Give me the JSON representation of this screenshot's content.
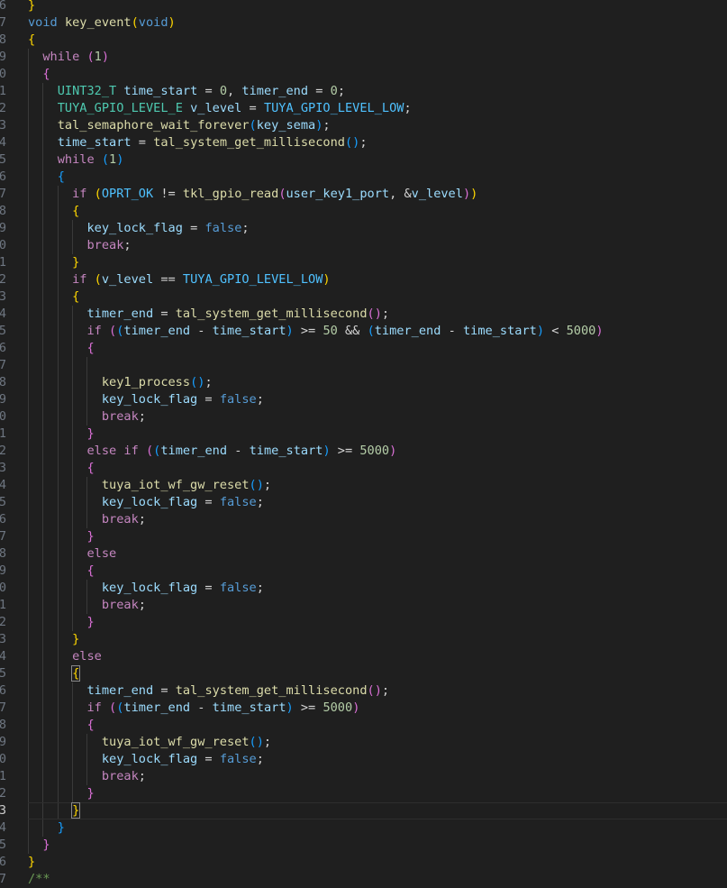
{
  "editor": {
    "line_numbers": [
      "6",
      "7",
      "8",
      "9",
      "0",
      "1",
      "2",
      "3",
      "4",
      "5",
      "6",
      "7",
      "8",
      "9",
      "0",
      "1",
      "2",
      "3",
      "4",
      "5",
      "6",
      "7",
      "8",
      "9",
      "0",
      "1",
      "2",
      "3",
      "4",
      "5",
      "6",
      "7",
      "8",
      "9",
      "0",
      "1",
      "2",
      "3",
      "4",
      "5",
      "6",
      "7",
      "8",
      "9",
      "0",
      "1",
      "2",
      "3",
      "4",
      "5",
      "6",
      "7"
    ],
    "current_line_index": 47,
    "lines": [
      [
        {
          "t": "}",
          "c": "b1"
        }
      ],
      [
        {
          "t": "void",
          "c": "kw"
        },
        {
          "t": " "
        },
        {
          "t": "key_event",
          "c": "fn"
        },
        {
          "t": "(",
          "c": "b1"
        },
        {
          "t": "void",
          "c": "kw"
        },
        {
          "t": ")",
          "c": "b1"
        }
      ],
      [
        {
          "t": "{",
          "c": "b1"
        }
      ],
      [
        {
          "t": "  "
        },
        {
          "t": "while",
          "c": "ctl"
        },
        {
          "t": " "
        },
        {
          "t": "(",
          "c": "b2"
        },
        {
          "t": "1",
          "c": "num"
        },
        {
          "t": ")",
          "c": "b2"
        }
      ],
      [
        {
          "t": "  "
        },
        {
          "t": "{",
          "c": "b2"
        }
      ],
      [
        {
          "t": "    "
        },
        {
          "t": "UINT32_T",
          "c": "ty"
        },
        {
          "t": " "
        },
        {
          "t": "time_start",
          "c": "var"
        },
        {
          "t": " = ",
          "c": "op"
        },
        {
          "t": "0",
          "c": "num"
        },
        {
          "t": ", ",
          "c": "op"
        },
        {
          "t": "timer_end",
          "c": "var"
        },
        {
          "t": " = ",
          "c": "op"
        },
        {
          "t": "0",
          "c": "num"
        },
        {
          "t": ";",
          "c": "op"
        }
      ],
      [
        {
          "t": "    "
        },
        {
          "t": "TUYA_GPIO_LEVEL_E",
          "c": "ty"
        },
        {
          "t": " "
        },
        {
          "t": "v_level",
          "c": "var"
        },
        {
          "t": " = ",
          "c": "op"
        },
        {
          "t": "TUYA_GPIO_LEVEL_LOW",
          "c": "cst"
        },
        {
          "t": ";",
          "c": "op"
        }
      ],
      [
        {
          "t": "    "
        },
        {
          "t": "tal_semaphore_wait_forever",
          "c": "fn"
        },
        {
          "t": "(",
          "c": "b3"
        },
        {
          "t": "key_sema",
          "c": "var"
        },
        {
          "t": ")",
          "c": "b3"
        },
        {
          "t": ";",
          "c": "op"
        }
      ],
      [
        {
          "t": "    "
        },
        {
          "t": "time_start",
          "c": "var"
        },
        {
          "t": " = ",
          "c": "op"
        },
        {
          "t": "tal_system_get_millisecond",
          "c": "fn"
        },
        {
          "t": "()",
          "c": "b3"
        },
        {
          "t": ";",
          "c": "op"
        }
      ],
      [
        {
          "t": "    "
        },
        {
          "t": "while",
          "c": "ctl"
        },
        {
          "t": " "
        },
        {
          "t": "(",
          "c": "b3"
        },
        {
          "t": "1",
          "c": "num"
        },
        {
          "t": ")",
          "c": "b3"
        }
      ],
      [
        {
          "t": "    "
        },
        {
          "t": "{",
          "c": "b3"
        }
      ],
      [
        {
          "t": "      "
        },
        {
          "t": "if",
          "c": "ctl"
        },
        {
          "t": " "
        },
        {
          "t": "(",
          "c": "b1"
        },
        {
          "t": "OPRT_OK",
          "c": "cst"
        },
        {
          "t": " != ",
          "c": "op"
        },
        {
          "t": "tkl_gpio_read",
          "c": "fn"
        },
        {
          "t": "(",
          "c": "b2"
        },
        {
          "t": "user_key1_port",
          "c": "var"
        },
        {
          "t": ", &",
          "c": "op"
        },
        {
          "t": "v_level",
          "c": "var"
        },
        {
          "t": ")",
          "c": "b2"
        },
        {
          "t": ")",
          "c": "b1"
        }
      ],
      [
        {
          "t": "      "
        },
        {
          "t": "{",
          "c": "b1"
        }
      ],
      [
        {
          "t": "        "
        },
        {
          "t": "key_lock_flag",
          "c": "var"
        },
        {
          "t": " = ",
          "c": "op"
        },
        {
          "t": "false",
          "c": "kw"
        },
        {
          "t": ";",
          "c": "op"
        }
      ],
      [
        {
          "t": "        "
        },
        {
          "t": "break",
          "c": "ctl"
        },
        {
          "t": ";",
          "c": "op"
        }
      ],
      [
        {
          "t": "      "
        },
        {
          "t": "}",
          "c": "b1"
        }
      ],
      [
        {
          "t": "      "
        },
        {
          "t": "if",
          "c": "ctl"
        },
        {
          "t": " "
        },
        {
          "t": "(",
          "c": "b1"
        },
        {
          "t": "v_level",
          "c": "var"
        },
        {
          "t": " == ",
          "c": "op"
        },
        {
          "t": "TUYA_GPIO_LEVEL_LOW",
          "c": "cst"
        },
        {
          "t": ")",
          "c": "b1"
        }
      ],
      [
        {
          "t": "      "
        },
        {
          "t": "{",
          "c": "b1"
        }
      ],
      [
        {
          "t": "        "
        },
        {
          "t": "timer_end",
          "c": "var"
        },
        {
          "t": " = ",
          "c": "op"
        },
        {
          "t": "tal_system_get_millisecond",
          "c": "fn"
        },
        {
          "t": "()",
          "c": "b2"
        },
        {
          "t": ";",
          "c": "op"
        }
      ],
      [
        {
          "t": "        "
        },
        {
          "t": "if",
          "c": "ctl"
        },
        {
          "t": " "
        },
        {
          "t": "(",
          "c": "b2"
        },
        {
          "t": "(",
          "c": "b3"
        },
        {
          "t": "timer_end",
          "c": "var"
        },
        {
          "t": " - ",
          "c": "op"
        },
        {
          "t": "time_start",
          "c": "var"
        },
        {
          "t": ")",
          "c": "b3"
        },
        {
          "t": " >= ",
          "c": "op"
        },
        {
          "t": "50",
          "c": "num"
        },
        {
          "t": " && ",
          "c": "op"
        },
        {
          "t": "(",
          "c": "b3"
        },
        {
          "t": "timer_end",
          "c": "var"
        },
        {
          "t": " - ",
          "c": "op"
        },
        {
          "t": "time_start",
          "c": "var"
        },
        {
          "t": ")",
          "c": "b3"
        },
        {
          "t": " < ",
          "c": "op"
        },
        {
          "t": "5000",
          "c": "num"
        },
        {
          "t": ")",
          "c": "b2"
        }
      ],
      [
        {
          "t": "        "
        },
        {
          "t": "{",
          "c": "b2"
        }
      ],
      [
        {
          "t": ""
        }
      ],
      [
        {
          "t": "          "
        },
        {
          "t": "key1_process",
          "c": "fn"
        },
        {
          "t": "()",
          "c": "b3"
        },
        {
          "t": ";",
          "c": "op"
        }
      ],
      [
        {
          "t": "          "
        },
        {
          "t": "key_lock_flag",
          "c": "var"
        },
        {
          "t": " = ",
          "c": "op"
        },
        {
          "t": "false",
          "c": "kw"
        },
        {
          "t": ";",
          "c": "op"
        }
      ],
      [
        {
          "t": "          "
        },
        {
          "t": "break",
          "c": "ctl"
        },
        {
          "t": ";",
          "c": "op"
        }
      ],
      [
        {
          "t": "        "
        },
        {
          "t": "}",
          "c": "b2"
        }
      ],
      [
        {
          "t": "        "
        },
        {
          "t": "else",
          "c": "ctl"
        },
        {
          "t": " "
        },
        {
          "t": "if",
          "c": "ctl"
        },
        {
          "t": " "
        },
        {
          "t": "(",
          "c": "b2"
        },
        {
          "t": "(",
          "c": "b3"
        },
        {
          "t": "timer_end",
          "c": "var"
        },
        {
          "t": " - ",
          "c": "op"
        },
        {
          "t": "time_start",
          "c": "var"
        },
        {
          "t": ")",
          "c": "b3"
        },
        {
          "t": " >= ",
          "c": "op"
        },
        {
          "t": "5000",
          "c": "num"
        },
        {
          "t": ")",
          "c": "b2"
        }
      ],
      [
        {
          "t": "        "
        },
        {
          "t": "{",
          "c": "b2"
        }
      ],
      [
        {
          "t": "          "
        },
        {
          "t": "tuya_iot_wf_gw_reset",
          "c": "fn"
        },
        {
          "t": "()",
          "c": "b3"
        },
        {
          "t": ";",
          "c": "op"
        }
      ],
      [
        {
          "t": "          "
        },
        {
          "t": "key_lock_flag",
          "c": "var"
        },
        {
          "t": " = ",
          "c": "op"
        },
        {
          "t": "false",
          "c": "kw"
        },
        {
          "t": ";",
          "c": "op"
        }
      ],
      [
        {
          "t": "          "
        },
        {
          "t": "break",
          "c": "ctl"
        },
        {
          "t": ";",
          "c": "op"
        }
      ],
      [
        {
          "t": "        "
        },
        {
          "t": "}",
          "c": "b2"
        }
      ],
      [
        {
          "t": "        "
        },
        {
          "t": "else",
          "c": "ctl"
        }
      ],
      [
        {
          "t": "        "
        },
        {
          "t": "{",
          "c": "b2"
        }
      ],
      [
        {
          "t": "          "
        },
        {
          "t": "key_lock_flag",
          "c": "var"
        },
        {
          "t": " = ",
          "c": "op"
        },
        {
          "t": "false",
          "c": "kw"
        },
        {
          "t": ";",
          "c": "op"
        }
      ],
      [
        {
          "t": "          "
        },
        {
          "t": "break",
          "c": "ctl"
        },
        {
          "t": ";",
          "c": "op"
        }
      ],
      [
        {
          "t": "        "
        },
        {
          "t": "}",
          "c": "b2"
        }
      ],
      [
        {
          "t": "      "
        },
        {
          "t": "}",
          "c": "b1"
        }
      ],
      [
        {
          "t": "      "
        },
        {
          "t": "else",
          "c": "ctl"
        }
      ],
      [
        {
          "t": "      "
        },
        {
          "t": "{",
          "c": "b1",
          "m": true
        }
      ],
      [
        {
          "t": "        "
        },
        {
          "t": "timer_end",
          "c": "var"
        },
        {
          "t": " = ",
          "c": "op"
        },
        {
          "t": "tal_system_get_millisecond",
          "c": "fn"
        },
        {
          "t": "()",
          "c": "b2"
        },
        {
          "t": ";",
          "c": "op"
        }
      ],
      [
        {
          "t": "        "
        },
        {
          "t": "if",
          "c": "ctl"
        },
        {
          "t": " "
        },
        {
          "t": "(",
          "c": "b2"
        },
        {
          "t": "(",
          "c": "b3"
        },
        {
          "t": "timer_end",
          "c": "var"
        },
        {
          "t": " - ",
          "c": "op"
        },
        {
          "t": "time_start",
          "c": "var"
        },
        {
          "t": ")",
          "c": "b3"
        },
        {
          "t": " >= ",
          "c": "op"
        },
        {
          "t": "5000",
          "c": "num"
        },
        {
          "t": ")",
          "c": "b2"
        }
      ],
      [
        {
          "t": "        "
        },
        {
          "t": "{",
          "c": "b2"
        }
      ],
      [
        {
          "t": "          "
        },
        {
          "t": "tuya_iot_wf_gw_reset",
          "c": "fn"
        },
        {
          "t": "()",
          "c": "b3"
        },
        {
          "t": ";",
          "c": "op"
        }
      ],
      [
        {
          "t": "          "
        },
        {
          "t": "key_lock_flag",
          "c": "var"
        },
        {
          "t": " = ",
          "c": "op"
        },
        {
          "t": "false",
          "c": "kw"
        },
        {
          "t": ";",
          "c": "op"
        }
      ],
      [
        {
          "t": "          "
        },
        {
          "t": "break",
          "c": "ctl"
        },
        {
          "t": ";",
          "c": "op"
        }
      ],
      [
        {
          "t": "        "
        },
        {
          "t": "}",
          "c": "b2"
        }
      ],
      [
        {
          "t": "      "
        },
        {
          "t": "}",
          "c": "b1",
          "m": true
        }
      ],
      [
        {
          "t": "    "
        },
        {
          "t": "}",
          "c": "b3"
        }
      ],
      [
        {
          "t": "  "
        },
        {
          "t": "}",
          "c": "b2"
        }
      ],
      [
        {
          "t": "}",
          "c": "b1"
        }
      ],
      [
        {
          "t": "/**",
          "c": "cm"
        }
      ]
    ]
  }
}
